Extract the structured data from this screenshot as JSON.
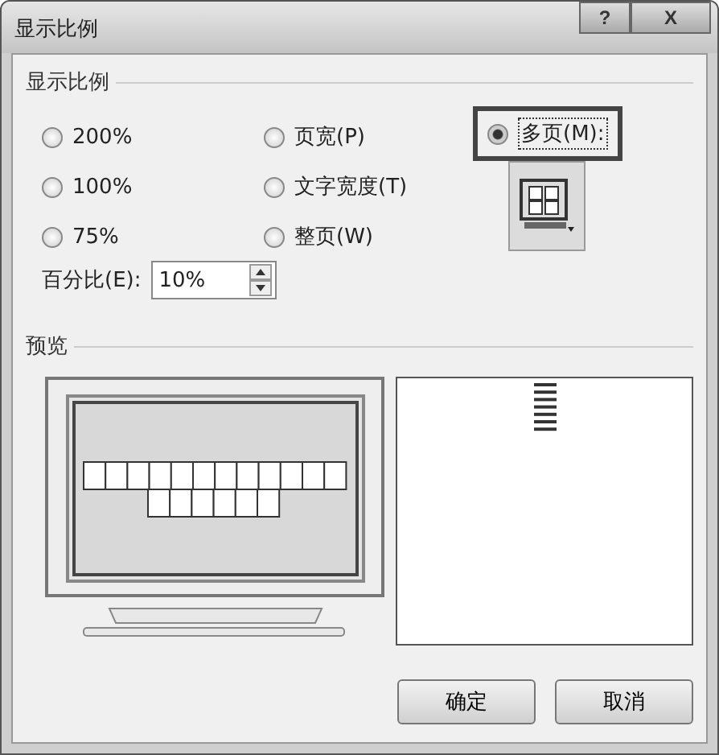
{
  "window": {
    "title": "显示比例",
    "buttons": [
      "?",
      "X"
    ]
  },
  "zoom_group": {
    "title": "显示比例",
    "options": [
      {
        "label": "200%",
        "selected": false
      },
      {
        "label": "页宽(P)",
        "selected": false
      },
      {
        "label": "100%",
        "selected": false
      },
      {
        "label": "文字宽度(T)",
        "selected": false
      },
      {
        "label": "75%",
        "selected": false
      },
      {
        "label": "整页(W)",
        "selected": false
      }
    ],
    "many_pages": {
      "label": "多页(M):",
      "selected": true
    },
    "percent": {
      "label": "百分比(E):",
      "value": "10%"
    }
  },
  "preview": {
    "title": "预览"
  },
  "buttons": [
    "确定",
    "取消"
  ]
}
